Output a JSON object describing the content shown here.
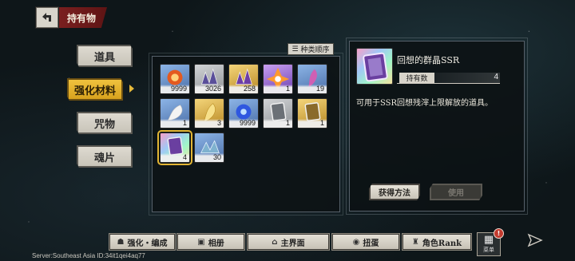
{
  "header": {
    "title": "持有物",
    "back_icon": "back-arrow-icon"
  },
  "categories": [
    {
      "label": "道具",
      "active": false
    },
    {
      "label": "强化材料",
      "active": true
    },
    {
      "label": "咒物",
      "active": false
    },
    {
      "label": "魂片",
      "active": false
    }
  ],
  "sort_button": {
    "label": "种类顺序",
    "icon": "sort-icon"
  },
  "items": [
    {
      "count": "9999",
      "rarity": "blue",
      "icon": "fire-orb-icon",
      "color": "#e45a1f"
    },
    {
      "count": "3026",
      "rarity": "gray",
      "icon": "crystal-cluster-icon",
      "color": "#5a4f9a"
    },
    {
      "count": "258",
      "rarity": "gold",
      "icon": "crystal-cluster-icon",
      "color": "#6c3da6"
    },
    {
      "count": "1",
      "rarity": "purple",
      "icon": "shattered-crystal-icon",
      "color": "#ff9a2e"
    },
    {
      "count": "19",
      "rarity": "blue",
      "icon": "feather-icon",
      "color": "#d05fb3"
    },
    {
      "count": "1",
      "rarity": "blue",
      "icon": "white-feather-icon",
      "color": "#f3f3f3"
    },
    {
      "count": "3",
      "rarity": "gold",
      "icon": "golden-feather-icon",
      "color": "#f7e08a"
    },
    {
      "count": "9999",
      "rarity": "blue",
      "icon": "blue-flame-icon",
      "color": "#2f58e0"
    },
    {
      "count": "1",
      "rarity": "gray",
      "icon": "mirror-shard-icon",
      "color": "#6b7076"
    },
    {
      "count": "1",
      "rarity": "gold",
      "icon": "mirror-shard-icon",
      "color": "#8a6a2a"
    },
    {
      "count": "4",
      "rarity": "rainbow",
      "icon": "mirror-shard-icon",
      "color": "#6a3fa0",
      "selected": true
    },
    {
      "count": "30",
      "rarity": "blue",
      "icon": "shard-pile-icon",
      "color": "#7fb2cf"
    }
  ],
  "detail": {
    "name": "回想的群晶SSR",
    "owned_label": "持有数",
    "owned_value": "4",
    "description": "可用于SSR回想残滓上限解放的道具。",
    "obtain_button": "获得方法",
    "use_button": "使用"
  },
  "bottom_nav": [
    {
      "label": "强化・编成",
      "icon": "team-icon"
    },
    {
      "label": "相册",
      "icon": "album-icon"
    },
    {
      "label": "主界面",
      "icon": "home-icon"
    },
    {
      "label": "扭蛋",
      "icon": "gacha-icon"
    },
    {
      "label": "角色Rank",
      "icon": "rank-icon"
    }
  ],
  "menu": {
    "label": "菜单",
    "alert": "!"
  },
  "server_info": "Server:Southeast Asia ID:34it1qei4aq77"
}
